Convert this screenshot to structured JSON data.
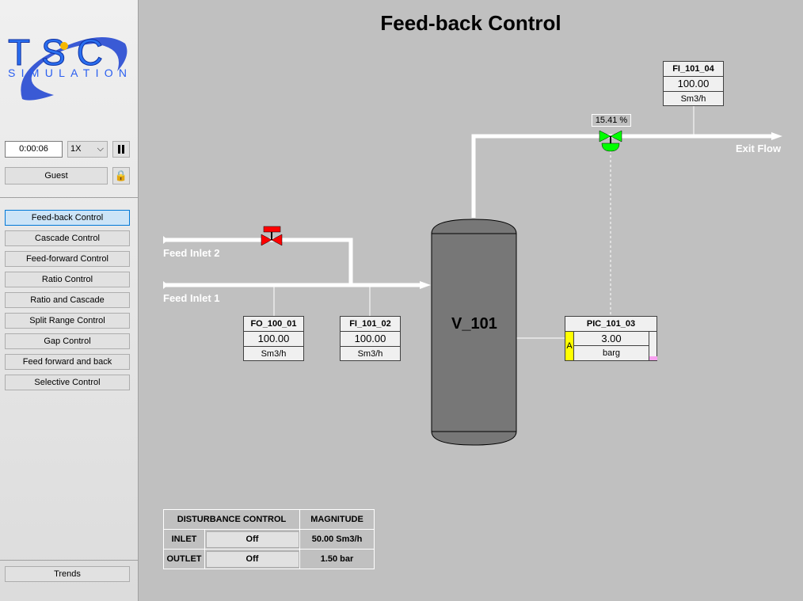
{
  "sidebar": {
    "logo_text": "TSC SIMULATION",
    "timer": "0:00:06",
    "speed": "1X",
    "user": "Guest",
    "nav": [
      {
        "label": "Feed-back Control",
        "active": true
      },
      {
        "label": "Cascade Control"
      },
      {
        "label": "Feed-forward Control"
      },
      {
        "label": "Ratio Control"
      },
      {
        "label": "Ratio and Cascade"
      },
      {
        "label": "Split Range Control"
      },
      {
        "label": "Gap Control"
      },
      {
        "label": "Feed forward and back"
      },
      {
        "label": "Selective Control"
      }
    ],
    "trends": "Trends"
  },
  "title": "Feed-back Control",
  "streams": {
    "inlet1": "Feed Inlet 1",
    "inlet2": "Feed Inlet 2",
    "exit": "Exit Flow"
  },
  "vessel": "V_101",
  "valve_output": "15.41 %",
  "instruments": {
    "fo": {
      "name": "FO_100_01",
      "value": "100.00",
      "unit": "Sm3/h"
    },
    "fi2": {
      "name": "FI_101_02",
      "value": "100.00",
      "unit": "Sm3/h"
    },
    "fi4": {
      "name": "FI_101_04",
      "value": "100.00",
      "unit": "Sm3/h"
    },
    "pic": {
      "name": "PIC_101_03",
      "value": "3.00",
      "unit": "barg",
      "mode": "A"
    }
  },
  "disturbance": {
    "header": "DISTURBANCE CONTROL",
    "mag_header": "MAGNITUDE",
    "rows": [
      {
        "label": "INLET",
        "state": "Off",
        "magnitude": "50.00 Sm3/h"
      },
      {
        "label": "OUTLET",
        "state": "Off",
        "magnitude": "1.50 bar"
      }
    ]
  },
  "colors": {
    "valve_open": "#00ff00",
    "valve_closed": "#ff0000",
    "vessel": "#777777",
    "active_nav": "#cce4f7"
  }
}
